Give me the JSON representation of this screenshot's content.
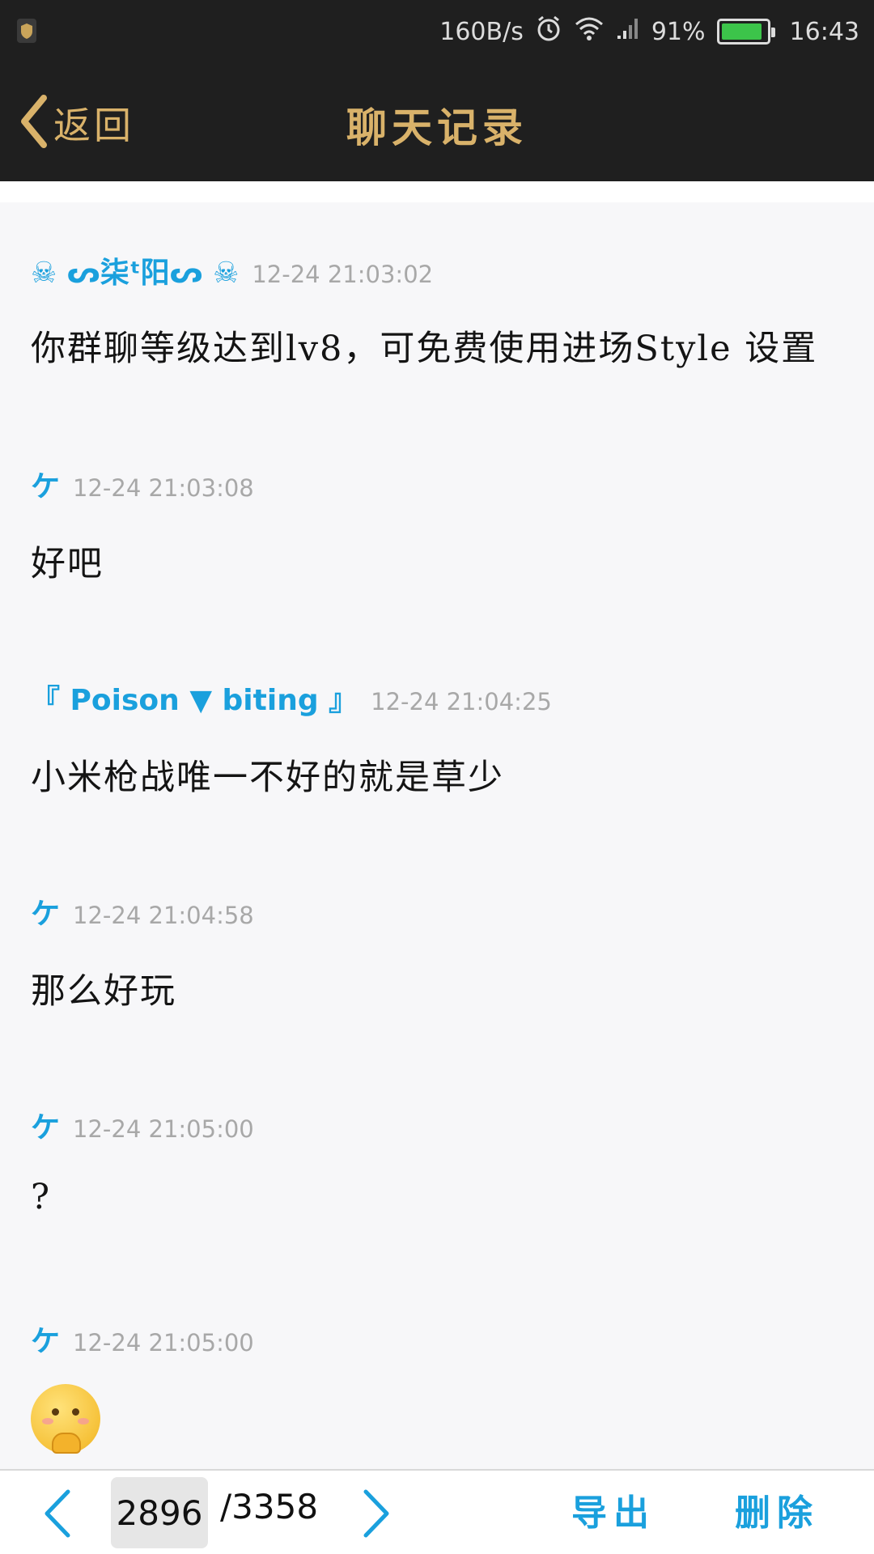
{
  "status_bar": {
    "net_speed": "160B/s",
    "battery_percent": "91%",
    "battery_level": 0.91,
    "time": "16:43",
    "icons": [
      "app-badge-icon",
      "alarm-icon",
      "wifi-icon",
      "signal-icon",
      "battery-icon"
    ]
  },
  "header": {
    "back_label": "返回",
    "title": "聊天记录"
  },
  "messages": [
    {
      "sender": "☠ ᔕ柒ᵗ阳ᔕ ☠",
      "time": "12-24 21:03:02",
      "text": "你群聊等级达到lv8，可免费使用进场Style 设置"
    },
    {
      "sender": "ケ",
      "time": "12-24 21:03:08",
      "text": "好吧"
    },
    {
      "sender": "『 Poison ▼ biting 』",
      "time": "12-24 21:04:25",
      "text": "小米枪战唯一不好的就是草少"
    },
    {
      "sender": "ケ",
      "time": "12-24 21:04:58",
      "text": "那么好玩"
    },
    {
      "sender": "ケ",
      "time": "12-24 21:05:00",
      "text": "?"
    },
    {
      "sender": "ケ",
      "time": "12-24 21:05:00",
      "text": ""
    }
  ],
  "pager": {
    "current_page": "2896",
    "total_pages": "/3358"
  },
  "actions": {
    "export_label": "导出",
    "delete_label": "删除"
  },
  "colors": {
    "header_bg": "#1f1f1f",
    "accent_gold": "#d9b26a",
    "accent_blue": "#1aa0dd",
    "battery_green": "#3cc44a"
  }
}
